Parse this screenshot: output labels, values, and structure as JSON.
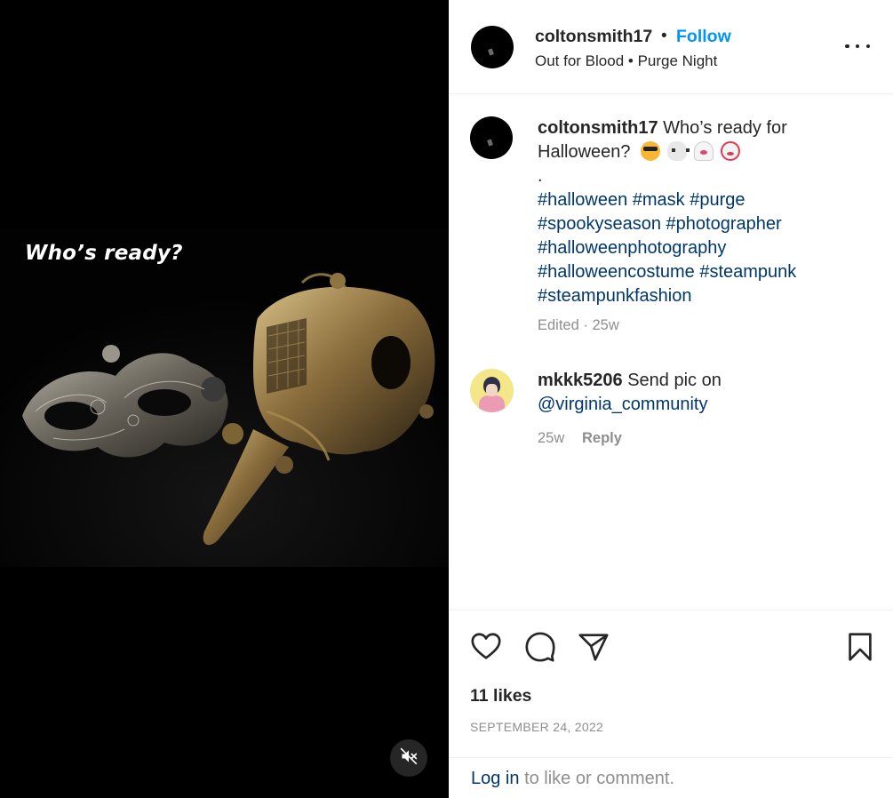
{
  "post": {
    "overlay_text": "Who’s ready?",
    "mute_icon": "muted-speaker-icon"
  },
  "header": {
    "username": "coltonsmith17",
    "separator": "•",
    "follow_label": "Follow",
    "location": "Out for Blood • Purge Night",
    "more_icon": "more-options-icon"
  },
  "caption": {
    "username": "coltonsmith17",
    "text": "Who’s ready for Halloween?",
    "emojis": [
      "smiling-face-with-sunglasses",
      "skull-and-crossbones",
      "ghost",
      "clown-face"
    ],
    "dot_line": ".",
    "hashtags": [
      "#halloween",
      "#mask",
      "#purge",
      "#spookyseason",
      "#photographer",
      "#halloweenphotography",
      "#halloweencostume",
      "#steampunk",
      "#steampunkfashion"
    ],
    "edited": "Edited",
    "meta_separator": " · ",
    "time": "25w"
  },
  "comment": {
    "username": "mkkk5206",
    "text_before": "Send pic on",
    "mention": "@virginia_community",
    "time": "25w",
    "reply_label": "Reply"
  },
  "actions": {
    "icons": [
      "heart-icon",
      "comment-bubble-icon",
      "paper-plane-icon",
      "bookmark-icon"
    ],
    "likes": "11 likes",
    "date": "SEPTEMBER 24, 2022"
  },
  "login": {
    "link_label": "Log in",
    "rest": "to like or comment."
  },
  "colors": {
    "follow_blue": "#0095f6",
    "link_dark_blue": "#00376b",
    "muted_gray": "#8e8e8e",
    "text": "#262626"
  }
}
